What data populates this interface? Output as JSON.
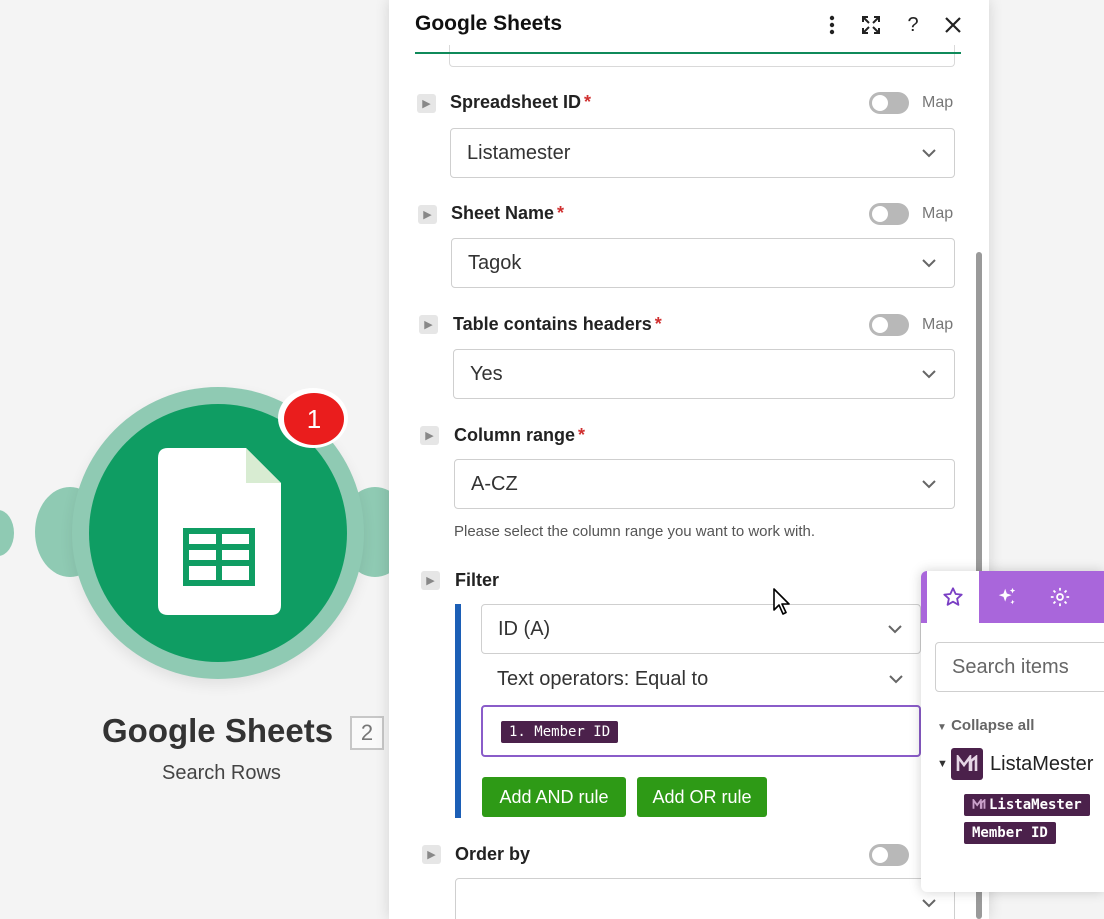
{
  "module": {
    "title": "Google Sheets",
    "count": "2",
    "subtitle": "Search Rows",
    "badge": "1",
    "icon": "google-sheets-icon",
    "colors": {
      "core": "#0f9d63",
      "halo": "#8fcab3",
      "badge": "#ea1d1d"
    }
  },
  "panel": {
    "title": "Google Sheets",
    "header_icons": [
      "more-vertical-icon",
      "expand-icon",
      "help-icon",
      "close-icon"
    ],
    "help_symbol": "?",
    "map_label": "Map",
    "fields": {
      "spreadsheet": {
        "label": "Spreadsheet ID",
        "required": "*",
        "value": "Listamester"
      },
      "sheet": {
        "label": "Sheet Name",
        "required": "*",
        "value": "Tagok"
      },
      "headers": {
        "label": "Table contains headers",
        "required": "*",
        "value": "Yes"
      },
      "range": {
        "label": "Column range",
        "required": "*",
        "value": "A-CZ",
        "help": "Please select the column range you want to work with."
      },
      "filter": {
        "label": "Filter",
        "column": "ID (A)",
        "operator": "Text operators: Equal to",
        "value_pill": "1. Member ID",
        "add_and": "Add AND rule",
        "add_or": "Add OR rule"
      },
      "order": {
        "label": "Order by",
        "value": ""
      }
    },
    "accent": "#0f8a5a"
  },
  "popover": {
    "tabs": [
      "star-icon",
      "sparkle-icon",
      "gear-icon",
      "more-icon"
    ],
    "search_placeholder": "Search items",
    "collapse_all": "Collapse all",
    "tree_item": "ListaMester",
    "pill_app": "ListaMester",
    "pill_field": "Member ID",
    "colors": {
      "tabs": "#a966db",
      "pill": "#4b214b"
    }
  }
}
